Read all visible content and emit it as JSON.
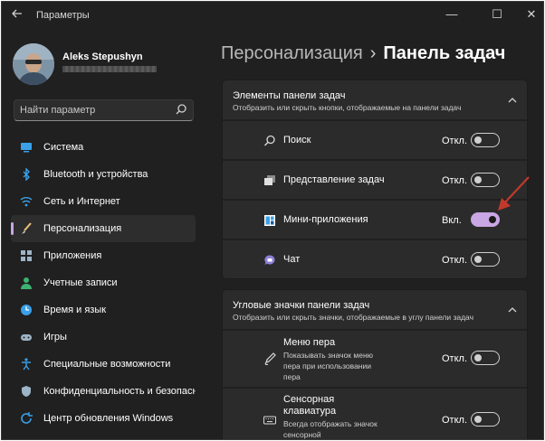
{
  "window": {
    "title": "Параметры",
    "controls": {
      "minimize": "—",
      "maximize": "☐",
      "close": "✕"
    }
  },
  "user": {
    "name": "Aleks Stepushyn"
  },
  "search": {
    "placeholder": "Найти параметр"
  },
  "sidebar": {
    "items": [
      {
        "label": "Система",
        "icon": "monitor-icon",
        "active": false
      },
      {
        "label": "Bluetooth и устройства",
        "icon": "bluetooth-icon",
        "active": false
      },
      {
        "label": "Сеть и Интернет",
        "icon": "wifi-icon",
        "active": false
      },
      {
        "label": "Персонализация",
        "icon": "brush-icon",
        "active": true
      },
      {
        "label": "Приложения",
        "icon": "apps-icon",
        "active": false
      },
      {
        "label": "Учетные записи",
        "icon": "person-icon",
        "active": false
      },
      {
        "label": "Время и язык",
        "icon": "globe-clock-icon",
        "active": false
      },
      {
        "label": "Игры",
        "icon": "gamepad-icon",
        "active": false
      },
      {
        "label": "Специальные возможности",
        "icon": "accessibility-icon",
        "active": false
      },
      {
        "label": "Конфиденциальность и безопасность",
        "icon": "shield-icon",
        "active": false
      },
      {
        "label": "Центр обновления Windows",
        "icon": "update-icon",
        "active": false
      }
    ]
  },
  "breadcrumb": {
    "parent": "Персонализация",
    "separator": "›",
    "current": "Панель задач"
  },
  "sections": {
    "taskbar_items": {
      "title": "Элементы панели задач",
      "subtitle": "Отобразить или скрыть кнопки, отображаемые на панели задач",
      "rows": [
        {
          "label": "Поиск",
          "icon": "search-icon",
          "state": "Откл.",
          "on": false
        },
        {
          "label": "Представление задач",
          "icon": "task-view-icon",
          "state": "Откл.",
          "on": false
        },
        {
          "label": "Мини-приложения",
          "icon": "widgets-icon",
          "state": "Вкл.",
          "on": true
        },
        {
          "label": "Чат",
          "icon": "chat-icon",
          "state": "Откл.",
          "on": false
        }
      ]
    },
    "corner_icons": {
      "title": "Угловые значки панели задач",
      "subtitle": "Отобразить или скрыть значки, отображаемые в углу панели задач",
      "rows": [
        {
          "label": "Меню пера",
          "desc": "Показывать значок меню пера при использовании пера",
          "icon": "pen-icon",
          "state": "Откл.",
          "on": false
        },
        {
          "label": "Сенсорная клавиатура",
          "desc": "Всегда отображать значок сенсорной",
          "icon": "keyboard-icon",
          "state": "Откл.",
          "on": false
        }
      ]
    }
  },
  "colors": {
    "accent": "#c9a6e4",
    "background": "#202020",
    "card": "#2b2b2b",
    "annotation_arrow": "#c0392b"
  }
}
